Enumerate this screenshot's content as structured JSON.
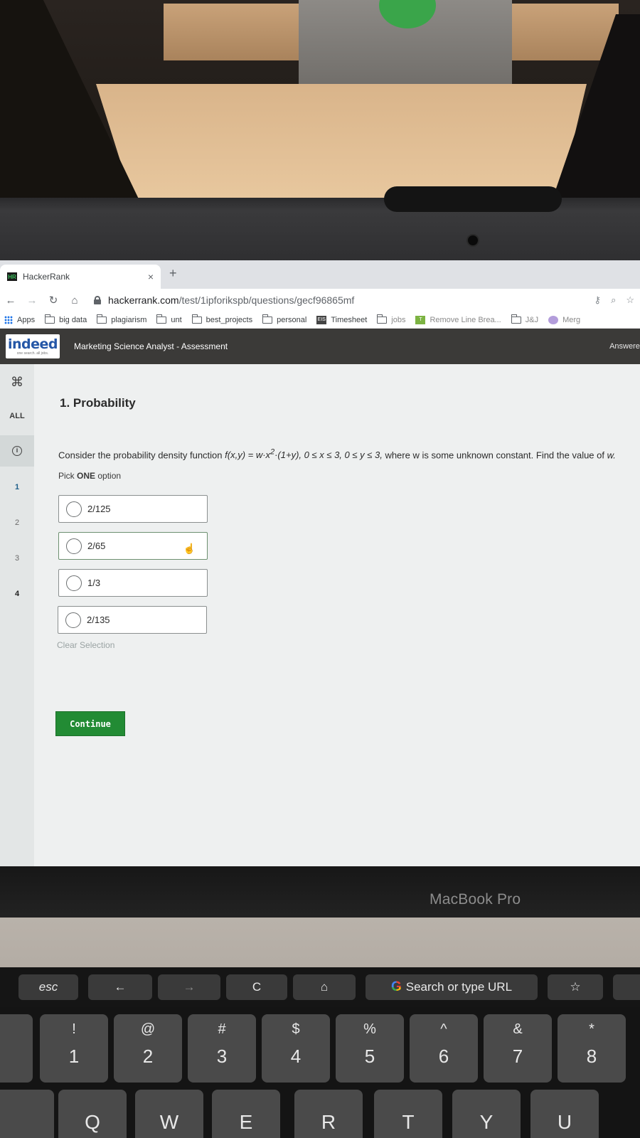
{
  "browser": {
    "tab_title": "HackerRank",
    "tab_favicon": "HR",
    "tab_close": "×",
    "new_tab": "+",
    "url_host": "hackerrank.com",
    "url_path": "/test/1ipforikspb/questions/gecf96865mf",
    "bookmarks": [
      {
        "label": "Apps",
        "icon": "apps-grid-icon"
      },
      {
        "label": "big data",
        "icon": "folder-icon"
      },
      {
        "label": "plagiarism",
        "icon": "folder-icon"
      },
      {
        "label": "unt",
        "icon": "folder-icon"
      },
      {
        "label": "best_projects",
        "icon": "folder-icon"
      },
      {
        "label": "personal",
        "icon": "folder-icon"
      },
      {
        "label": "Timesheet",
        "icon": "eis-icon",
        "badge": "EIS"
      },
      {
        "label": "jobs",
        "icon": "folder-icon"
      },
      {
        "label": "Remove Line Brea...",
        "icon": "t-icon",
        "badge": "T"
      },
      {
        "label": "J&J",
        "icon": "folder-icon"
      },
      {
        "label": "Merg",
        "icon": "merge-icon"
      }
    ]
  },
  "header": {
    "logo_word": "indeed",
    "logo_tagline": "one search. all jobs.",
    "title": "Marketing Science Analyst - Assessment",
    "status": "Answered"
  },
  "sidebar": {
    "command_icon": "⌘",
    "all_label": "ALL",
    "info_glyph": "i",
    "questions": [
      "1",
      "2",
      "3",
      "4"
    ]
  },
  "question": {
    "title": "1. Probability",
    "text_prefix": "Consider the probability density function ",
    "formula_a": "f(x,y) = w·x",
    "formula_sup": "2",
    "formula_b": "·(1+y), 0 ≤ x ≤ 3, 0 ≤ y ≤ 3,",
    "text_mid": " where w is some unknown constant. Find the value of ",
    "text_var": "w.",
    "pick_prefix": "Pick ",
    "pick_bold": "ONE",
    "pick_suffix": " option",
    "options": [
      "2/125",
      "2/65",
      "1/3",
      "2/135"
    ],
    "clear_label": "Clear Selection",
    "continue_label": "Continue"
  },
  "device": {
    "model_label": "MacBook Pro",
    "touchbar": {
      "esc": "esc",
      "back": "←",
      "forward": "→",
      "reload": "C",
      "home": "⌂",
      "search_g": "G",
      "search": "Search or type URL",
      "star": "☆"
    },
    "number_keys": [
      {
        "sym": "!",
        "num": "1"
      },
      {
        "sym": "@",
        "num": "2"
      },
      {
        "sym": "#",
        "num": "3"
      },
      {
        "sym": "$",
        "num": "4"
      },
      {
        "sym": "%",
        "num": "5"
      },
      {
        "sym": "^",
        "num": "6"
      },
      {
        "sym": "&",
        "num": "7"
      },
      {
        "sym": "*",
        "num": "8"
      }
    ],
    "letter_keys": [
      "Q",
      "W",
      "E",
      "R",
      "T",
      "Y",
      "U"
    ]
  }
}
